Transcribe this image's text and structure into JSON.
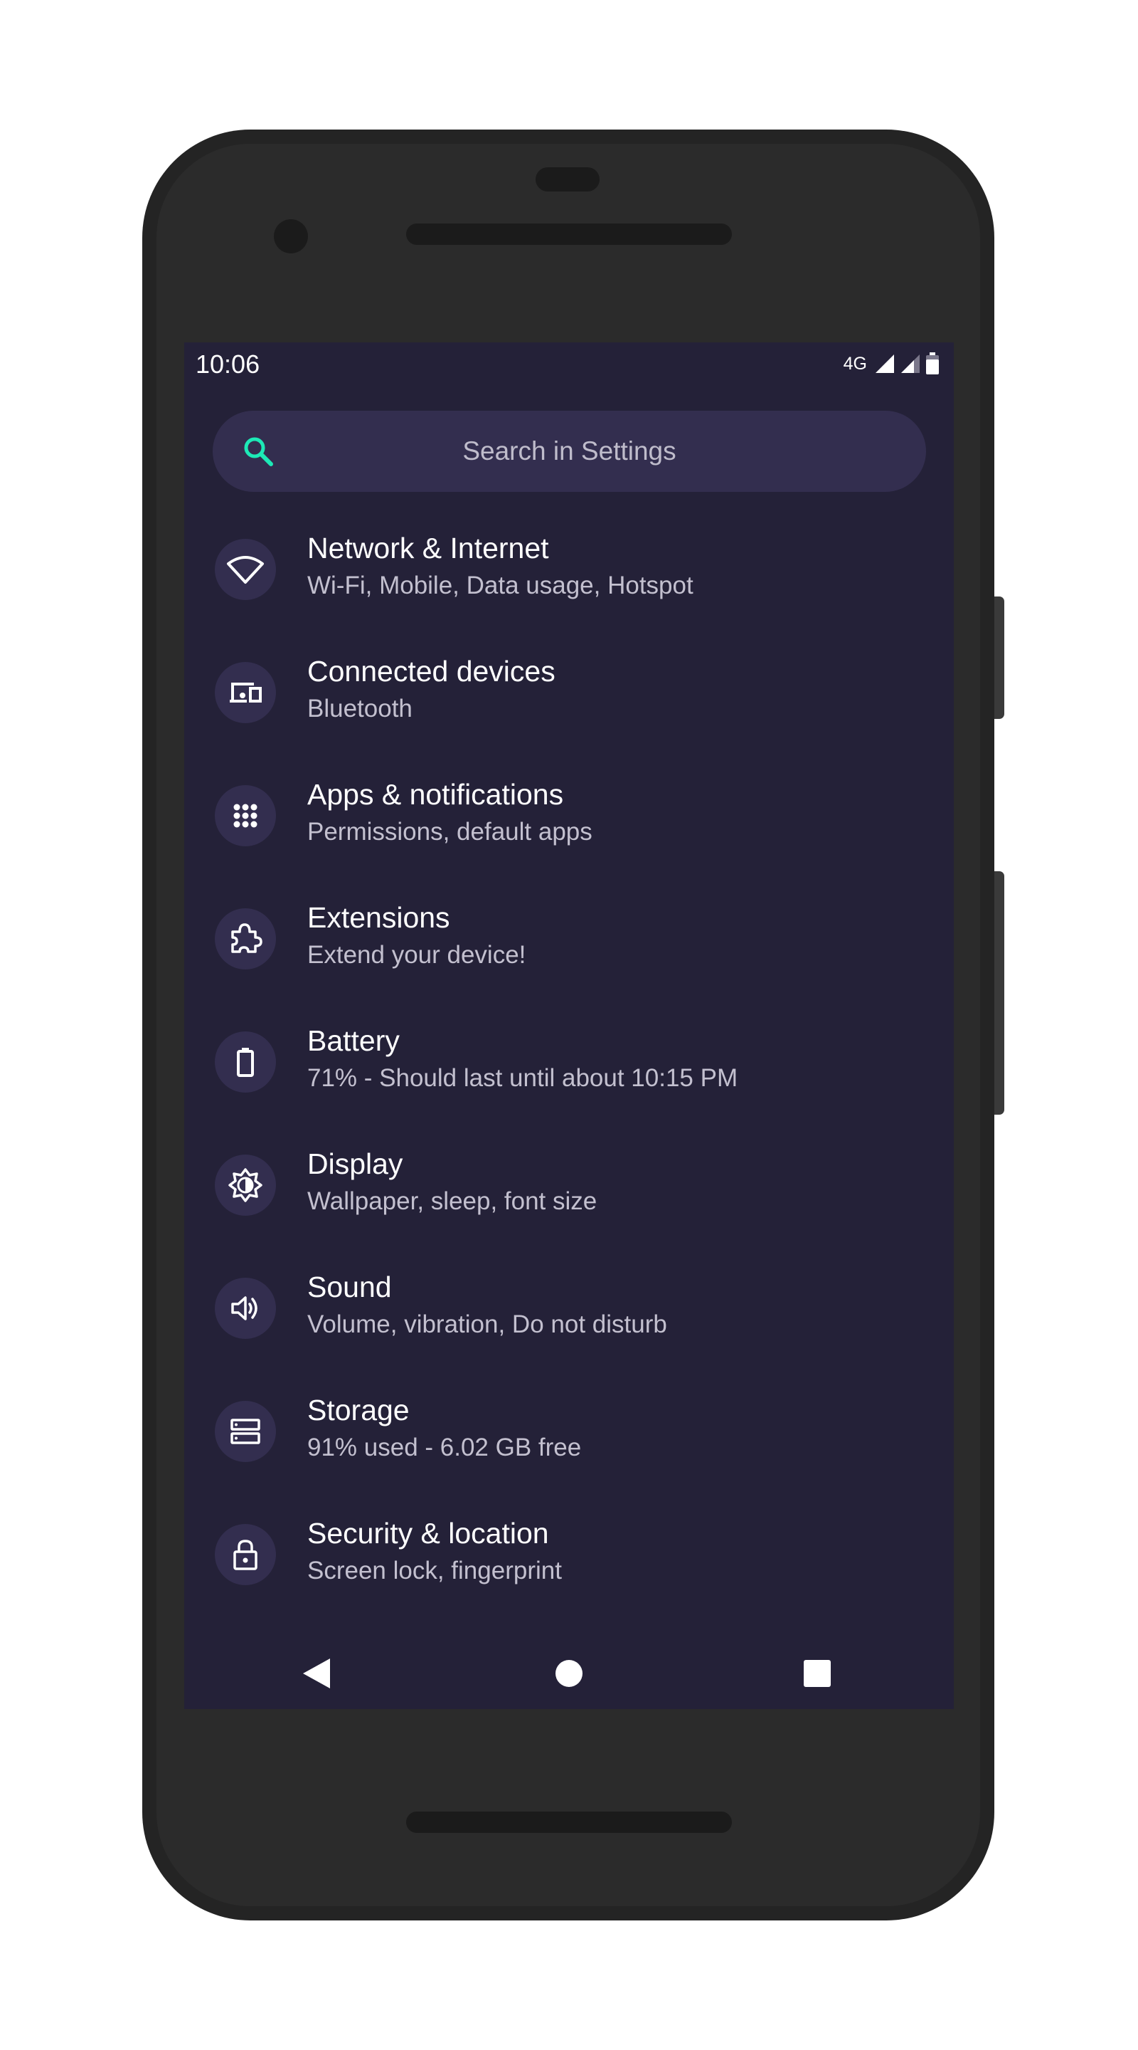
{
  "status_bar": {
    "time": "10:06",
    "network": "4G"
  },
  "search": {
    "placeholder": "Search in Settings"
  },
  "settings_items": [
    {
      "title": "Network & Internet",
      "subtitle": "Wi-Fi, Mobile, Data usage, Hotspot",
      "icon": "wifi-icon"
    },
    {
      "title": "Connected devices",
      "subtitle": "Bluetooth",
      "icon": "devices-icon"
    },
    {
      "title": "Apps & notifications",
      "subtitle": "Permissions, default apps",
      "icon": "apps-grid-icon"
    },
    {
      "title": "Extensions",
      "subtitle": "Extend your device!",
      "icon": "puzzle-icon"
    },
    {
      "title": "Battery",
      "subtitle": "71% - Should last until about 10:15 PM",
      "icon": "battery-icon"
    },
    {
      "title": "Display",
      "subtitle": "Wallpaper, sleep, font size",
      "icon": "brightness-icon"
    },
    {
      "title": "Sound",
      "subtitle": "Volume, vibration, Do not disturb",
      "icon": "volume-icon"
    },
    {
      "title": "Storage",
      "subtitle": "91% used - 6.02 GB free",
      "icon": "storage-icon"
    },
    {
      "title": "Security & location",
      "subtitle": "Screen lock, fingerprint",
      "icon": "lock-icon"
    }
  ],
  "colors": {
    "background": "#242138",
    "surface": "#332e4f",
    "accent": "#1de9b6",
    "text_primary": "#ffffff",
    "text_secondary": "#c3c0cf",
    "phone_body": "#242424"
  }
}
